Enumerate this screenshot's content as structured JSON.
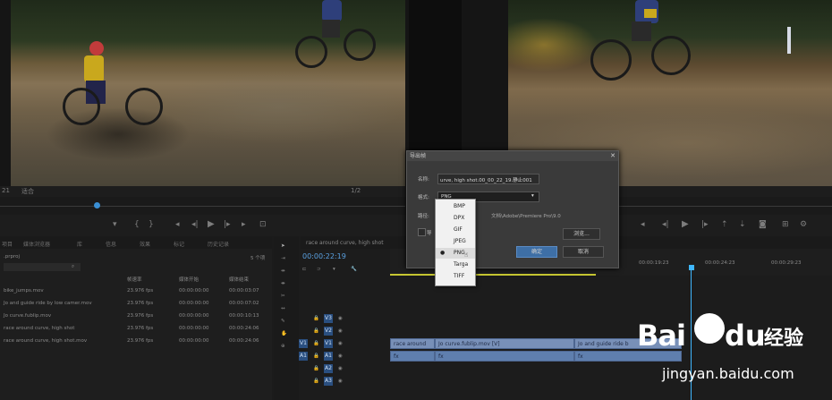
{
  "source_monitor": {
    "timecode_short": "21",
    "zoom_label": "适合",
    "fraction": "1/2"
  },
  "project_panel": {
    "tabs": [
      "项目",
      "媒体浏览器",
      "库",
      "信息",
      "效果",
      "标记",
      "历史记录"
    ],
    "name": ".prproj",
    "count": "5 个项",
    "columns": [
      "名称",
      "帧速率",
      "媒体开始",
      "媒体结束"
    ],
    "rows": [
      {
        "name": "bike_jumps.mov",
        "fps": "23.976 fps",
        "start": "00:00:00:00",
        "end": "00:00:03:07"
      },
      {
        "name": "Jo and guide ride by low camer.mov",
        "fps": "23.976 fps",
        "start": "00:00:00:00",
        "end": "00:00:07:02"
      },
      {
        "name": "Jo curve.fublip.mov",
        "fps": "23.976 fps",
        "start": "00:00:00:00",
        "end": "00:00:10:13"
      },
      {
        "name": "race around curve, high shot",
        "fps": "23.976 fps",
        "start": "00:00:00:00",
        "end": "00:00:24:06"
      },
      {
        "name": "race around curve, high shot.mov",
        "fps": "23.976 fps",
        "start": "00:00:00:00",
        "end": "00:00:24:06"
      }
    ]
  },
  "timeline": {
    "tab_label": "race around curve, high shot",
    "timecode": "00:00:22:19",
    "ruler": [
      "00:00:19:23",
      "00:00:24:23",
      "00:00:29:23"
    ],
    "tracks": [
      {
        "id": "V3",
        "src": ""
      },
      {
        "id": "V2",
        "src": ""
      },
      {
        "id": "V1",
        "src": "V1"
      },
      {
        "id": "A1",
        "src": "A1"
      },
      {
        "id": "A2",
        "src": ""
      },
      {
        "id": "A3",
        "src": ""
      }
    ],
    "clips_video": [
      "race around",
      "Jo curve.fublip.mov [V]",
      "Jo and guide ride b"
    ],
    "clip_fx": "fx"
  },
  "dialog": {
    "title": "导出帧",
    "name_label": "名称:",
    "name_value": "urve, high shot.00_00_22_19.静止001",
    "format_label": "格式:",
    "format_value": "PNG",
    "path_label": "路径:",
    "path_value": "文档\\Adobe\\Premiere Pro\\9.0",
    "import_label": "导",
    "browse_label": "浏览...",
    "ok_label": "确定",
    "cancel_label": "取消",
    "options": [
      "BMP",
      "DPX",
      "GIF",
      "JPEG",
      "PNG",
      "Targa",
      "TIFF"
    ],
    "selected_option": "PNG"
  },
  "watermark": {
    "brand": "Bai",
    "brand_tail": "du",
    "product": "经验",
    "url": "jingyan.baidu.com"
  },
  "colors": {
    "accent": "#3a8fd4",
    "playhead": "#3fb7ff",
    "dialog_ok": "#3e6fa6",
    "watermark": "#ffffff"
  }
}
